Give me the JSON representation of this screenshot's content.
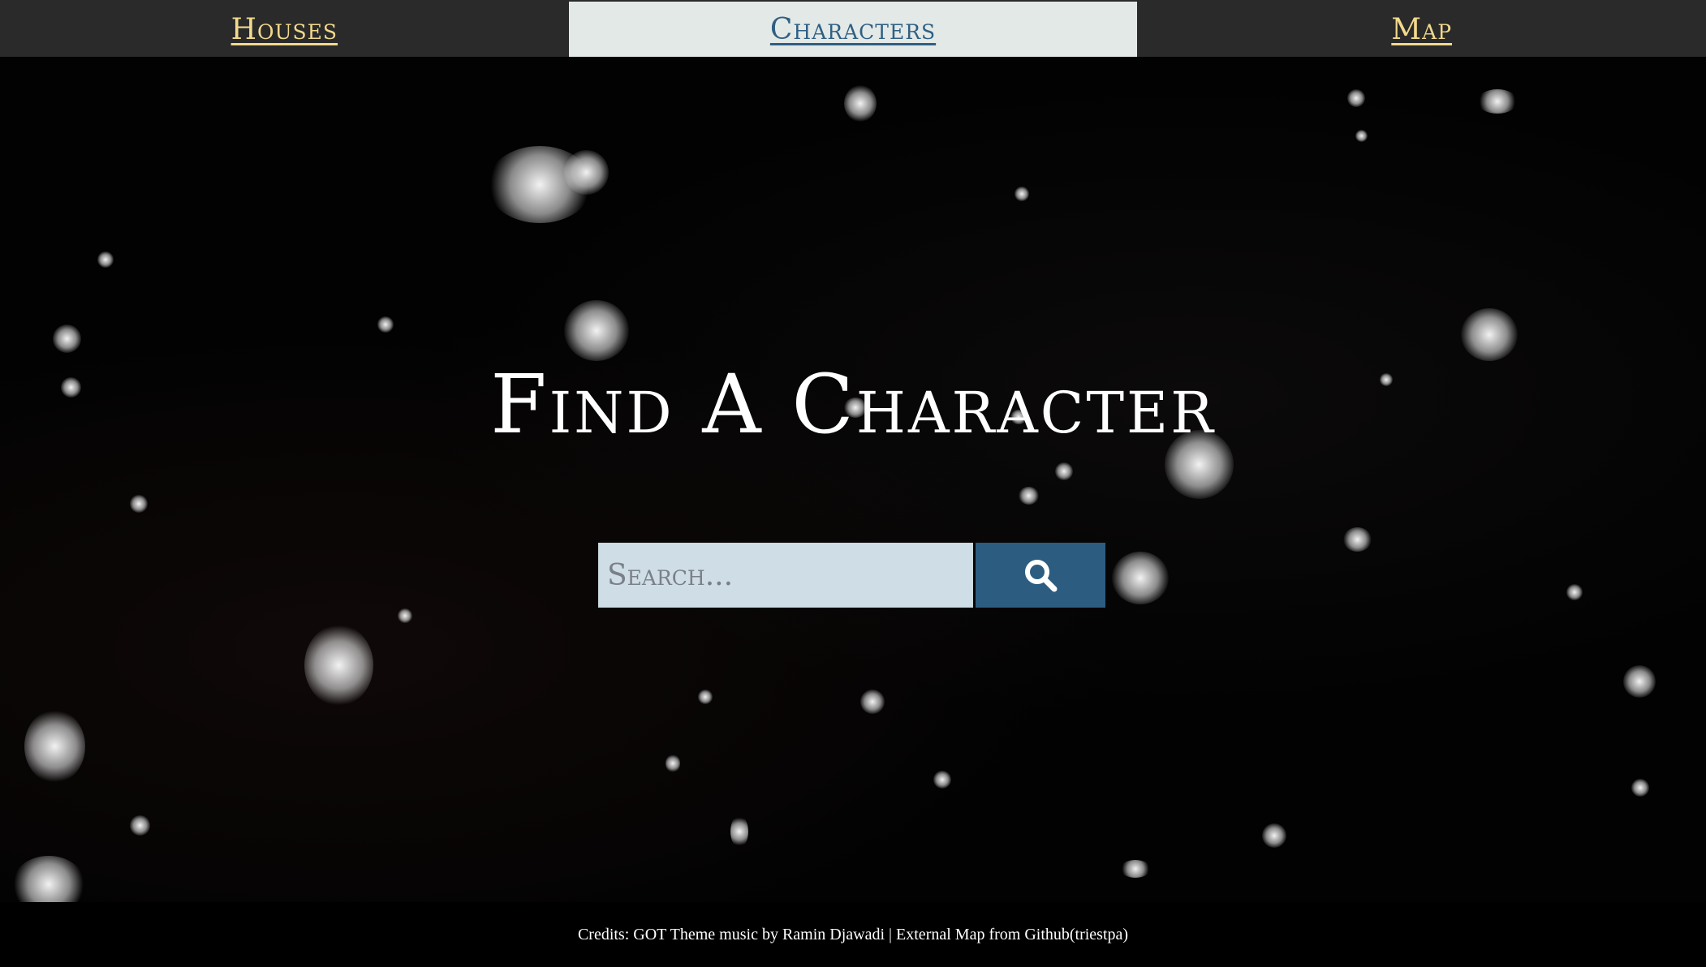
{
  "nav": {
    "items": [
      {
        "label": "Houses"
      },
      {
        "label": "Characters"
      },
      {
        "label": "Map"
      }
    ],
    "active_index": 1
  },
  "hero": {
    "title": "Find A Character"
  },
  "search": {
    "placeholder": "Search...",
    "value": "",
    "button_icon": "search-icon"
  },
  "footer": {
    "credits": "Credits: GOT Theme music by Ramin Djawadi | External Map from Github(triestpa)"
  },
  "colors": {
    "nav_background": "#2a2a2a",
    "nav_link": "#f2d98c",
    "nav_active_background": "#e3e9e7",
    "nav_active_link": "#2f5f82",
    "search_input_background": "#cfdde6",
    "search_button_background": "#2c5d80"
  }
}
